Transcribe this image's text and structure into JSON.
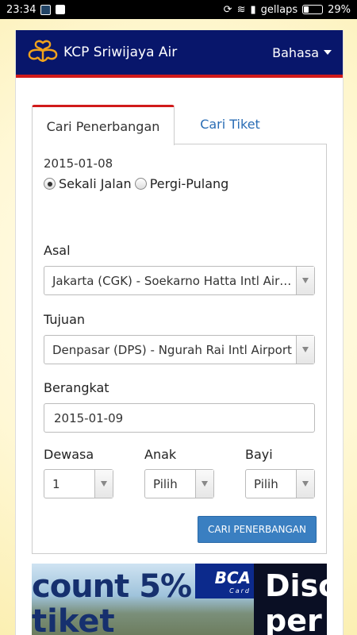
{
  "status_bar": {
    "time": "23:34",
    "carrier": "gellaps",
    "battery": "29%"
  },
  "header": {
    "brand": "KCP Sriwijaya Air",
    "language": "Bahasa"
  },
  "tabs": [
    {
      "label": "Cari Penerbangan"
    },
    {
      "label": "Cari Tiket"
    }
  ],
  "form": {
    "date_display": "2015-01-08",
    "trip_options": [
      {
        "label": "Sekali Jalan",
        "selected": true
      },
      {
        "label": "Pergi-Pulang",
        "selected": false
      }
    ],
    "origin": {
      "label": "Asal",
      "value": "Jakarta (CGK) - Soekarno Hatta Intl Airport"
    },
    "destination": {
      "label": "Tujuan",
      "value": "Denpasar (DPS) - Ngurah Rai Intl Airport"
    },
    "departure": {
      "label": "Berangkat",
      "value": "2015-01-09"
    },
    "passengers": [
      {
        "label": "Dewasa",
        "value": "1"
      },
      {
        "label": "Anak",
        "value": "Pilih"
      },
      {
        "label": "Bayi",
        "value": "Pilih"
      }
    ],
    "search_button": "CARI PENERBANGAN"
  },
  "banner": {
    "line1": "count 5%",
    "line2": "tiket",
    "bank": "BCA",
    "card": "Card",
    "right1": "Disc",
    "right2": "per"
  },
  "colors": {
    "header_bg": "#08166b",
    "accent_red": "#d11a1a",
    "link_blue": "#2a6db5",
    "button_blue": "#3a7fc1"
  }
}
